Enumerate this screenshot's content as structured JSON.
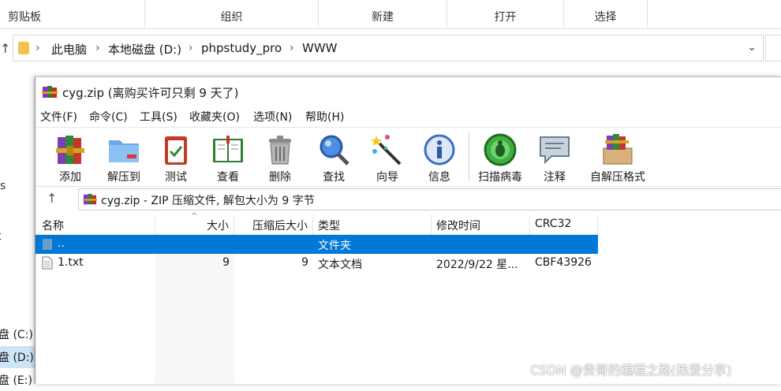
{
  "explorer": {
    "ribbon_groups": [
      "剪贴板",
      "组织",
      "新建",
      "打开",
      "选择"
    ],
    "breadcrumbs": [
      "此电脑",
      "本地磁盘 (D:)",
      "phpstudy_pro",
      "WWW"
    ],
    "nav_items": [
      {
        "label": "盘 (C:)",
        "selected": false
      },
      {
        "label": "盘 (D:)",
        "selected": true
      },
      {
        "label": "盘 (E:)",
        "selected": false
      }
    ],
    "fragments": [
      "s",
      "t"
    ]
  },
  "rar": {
    "title": "cyg.zip (离购买许可只剩 9 天了)",
    "menu": [
      "文件(F)",
      "命令(C)",
      "工具(S)",
      "收藏夹(O)",
      "选项(N)",
      "帮助(H)"
    ],
    "toolbar": [
      {
        "label": "添加",
        "icon": "add-books-icon"
      },
      {
        "label": "解压到",
        "icon": "extract-folder-icon"
      },
      {
        "label": "测试",
        "icon": "test-clipboard-icon"
      },
      {
        "label": "查看",
        "icon": "view-book-icon"
      },
      {
        "label": "删除",
        "icon": "trash-icon"
      },
      {
        "label": "查找",
        "icon": "magnifier-icon"
      },
      {
        "label": "向导",
        "icon": "wizard-wand-icon"
      },
      {
        "label": "信息",
        "icon": "info-icon"
      },
      {
        "label": "扫描病毒",
        "icon": "virus-scan-icon"
      },
      {
        "label": "注释",
        "icon": "comment-bubble-icon"
      },
      {
        "label": "自解压格式",
        "icon": "sfx-box-icon"
      }
    ],
    "path": "cyg.zip - ZIP 压缩文件, 解包大小为 9 字节",
    "columns": [
      "名称",
      "大小",
      "压缩后大小",
      "类型",
      "修改时间",
      "CRC32"
    ],
    "rows": [
      {
        "name": "..",
        "size": "",
        "packed": "",
        "type": "文件夹",
        "modified": "",
        "crc": "",
        "selected": true
      },
      {
        "name": "1.txt",
        "size": "9",
        "packed": "9",
        "type": "文本文档",
        "modified": "2022/9/22 星...",
        "crc": "CBF43926",
        "selected": false
      }
    ]
  },
  "watermark": "CSDN @贵哥的编程之路(热爱分享)",
  "colors": {
    "selection": "#0078d7",
    "folder": "#f2c24b"
  }
}
